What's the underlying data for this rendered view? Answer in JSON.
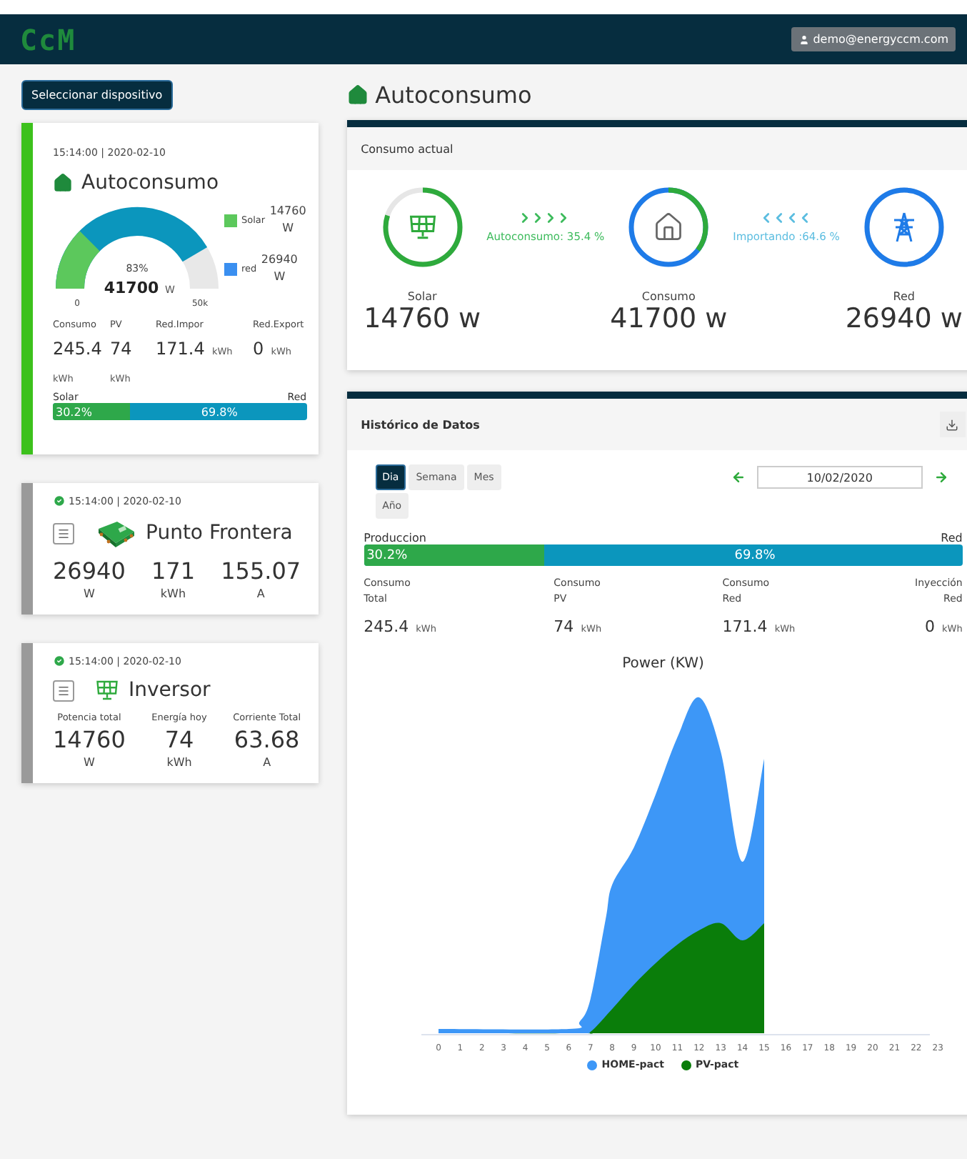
{
  "navbar": {
    "logo": "CcM",
    "user": "demo@energyccm.com"
  },
  "select_button": "Seleccionar dispositivo",
  "summary_card": {
    "timestamp": "15:14:00 | 2020-02-10",
    "title": "Autoconsumo",
    "gauge": {
      "percent": "83%",
      "value": "41700",
      "unit": "W",
      "min": "0",
      "max": "50k"
    },
    "legend": [
      {
        "label": "Solar",
        "value": "14760 W",
        "color": "#5cc85c"
      },
      {
        "label": "red",
        "value": "26940 W",
        "color": "#3a8ff0"
      }
    ],
    "stats": [
      {
        "label": "Consumo",
        "value": "245.4",
        "unit": "kWh"
      },
      {
        "label": "PV",
        "value": "74",
        "unit": "kWh"
      },
      {
        "label": "Red.Impor",
        "value": "171.4",
        "unit": "kWh"
      },
      {
        "label": "Red.Export",
        "value": "0",
        "unit": "kWh"
      }
    ],
    "bar": {
      "left_label": "Solar",
      "right_label": "Red",
      "level": 0.302,
      "left_text": "30.2%",
      "right_text": "69.8%"
    }
  },
  "device_cards": [
    {
      "kind": "meter",
      "timestamp": "15:14:00 | 2020-02-10",
      "online": true,
      "title": "Punto Frontera",
      "metrics": [
        {
          "value": "26940",
          "unit": "W"
        },
        {
          "value": "171",
          "unit": "kWh"
        },
        {
          "value": "155.07",
          "unit": "A"
        }
      ]
    },
    {
      "kind": "inverter",
      "timestamp": "15:14:00 | 2020-02-10",
      "online": true,
      "title": "Inversor",
      "metrics": [
        {
          "label": "Potencia total",
          "value": "14760",
          "unit": "W"
        },
        {
          "label": "Energía hoy",
          "value": "74",
          "unit": "kWh"
        },
        {
          "label": "Corriente Total",
          "value": "63.68",
          "unit": "A"
        }
      ]
    }
  ],
  "page_title": "Autoconsumo",
  "current": {
    "title": "Consumo actual",
    "nodes": [
      {
        "kind": "solar",
        "label": "Solar",
        "value": "14760",
        "unit": "w",
        "level": 0.8,
        "color": "#2eaa3c"
      },
      {
        "kind": "home",
        "label": "Consumo",
        "value": "41700",
        "unit": "w",
        "level": 0.354,
        "color": "#2eaa3c"
      },
      {
        "kind": "grid",
        "label": "Red",
        "value": "26940",
        "unit": "w",
        "level": 1,
        "color": "#1e7be8"
      }
    ],
    "flows": [
      {
        "label": "Autoconsumo: 35.4 %",
        "color": "#3dbb5c"
      },
      {
        "label": "Importando :64.6 %",
        "color": "#5bbde0"
      }
    ]
  },
  "history": {
    "title": "Histórico de Datos",
    "periods": [
      {
        "label": "Dia",
        "selected": true
      },
      {
        "label": "Semana",
        "selected": false
      },
      {
        "label": "Mes",
        "selected": false
      },
      {
        "label": "Año",
        "selected": false
      }
    ],
    "date": "10/02/2020",
    "bar": {
      "left_label": "Produccion",
      "right_label": "Red",
      "level": 0.302,
      "left_text": "30.2%",
      "right_text": "69.8%"
    },
    "stats": [
      {
        "label": "Consumo Total",
        "value": "245.4",
        "unit": "kWh"
      },
      {
        "label": "Consumo PV",
        "value": "74",
        "unit": "kWh"
      },
      {
        "label": "Consumo Red",
        "value": "171.4",
        "unit": "kWh"
      },
      {
        "label": "Inyección Red",
        "value": "0",
        "unit": "kWh"
      }
    ],
    "chart": {
      "title": "Power (KW)",
      "x_labels": [
        "0",
        "1",
        "2",
        "3",
        "4",
        "5",
        "6",
        "7",
        "8",
        "9",
        "10",
        "11",
        "12",
        "13",
        "14",
        "15",
        "16",
        "17",
        "18",
        "19",
        "20",
        "21",
        "22",
        "23"
      ],
      "legend": [
        {
          "label": "HOME-pact",
          "color": "#3d97f7"
        },
        {
          "label": "PV-pact",
          "color": "#0a7d0a"
        }
      ]
    }
  }
}
